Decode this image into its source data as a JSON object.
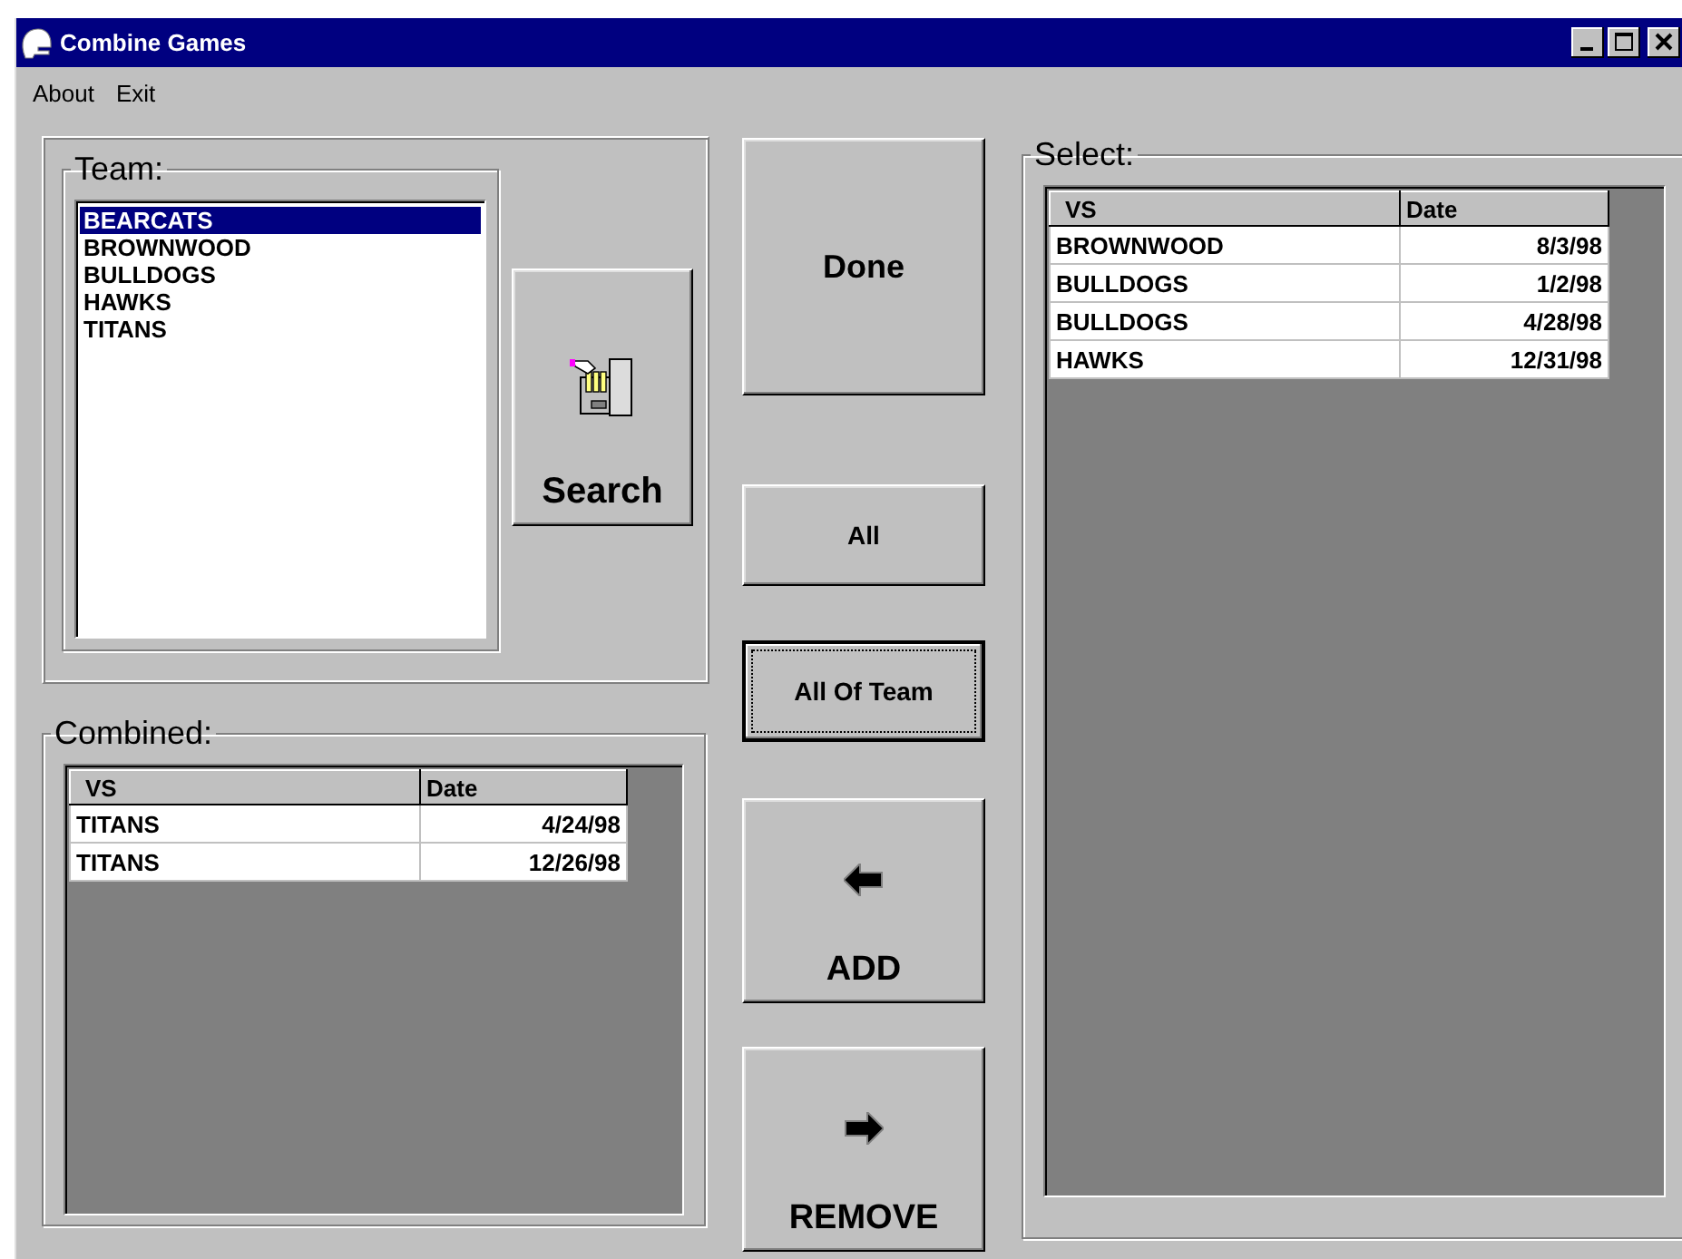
{
  "window": {
    "title": "Combine Games"
  },
  "menu": [
    {
      "label": "About"
    },
    {
      "label": "Exit"
    }
  ],
  "team": {
    "label": "Team:",
    "items": [
      {
        "label": "BEARCATS",
        "selected": true
      },
      {
        "label": "BROWNWOOD",
        "selected": false
      },
      {
        "label": "BULLDOGS",
        "selected": false
      },
      {
        "label": "HAWKS",
        "selected": false
      },
      {
        "label": "TITANS",
        "selected": false
      }
    ]
  },
  "search_button": {
    "label": "Search"
  },
  "combined": {
    "label": "Combined:",
    "columns": [
      "VS",
      "Date"
    ],
    "rows": [
      [
        "TITANS",
        "4/24/98"
      ],
      [
        "TITANS",
        "12/26/98"
      ]
    ]
  },
  "buttons": [
    {
      "label": "Done",
      "kind": "large",
      "focused": false
    },
    {
      "label": "All",
      "kind": "small",
      "focused": false
    },
    {
      "label": "All Of Team",
      "kind": "small",
      "focused": true
    },
    {
      "label": "ADD",
      "kind": "arrow-left",
      "focused": false
    },
    {
      "label": "REMOVE",
      "kind": "arrow-right",
      "focused": false
    }
  ],
  "select": {
    "label": "Select:",
    "columns": [
      "VS",
      "Date"
    ],
    "rows": [
      [
        "BROWNWOOD",
        "8/3/98"
      ],
      [
        "BULLDOGS",
        "1/2/98"
      ],
      [
        "BULLDOGS",
        "4/28/98"
      ],
      [
        "HAWKS",
        "12/31/98"
      ]
    ]
  }
}
